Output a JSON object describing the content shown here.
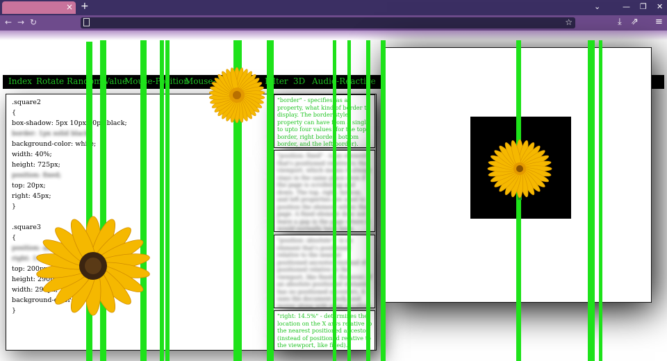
{
  "browser": {
    "tab_close": "×",
    "new_tab": "+",
    "dropdown": "⌄",
    "minimize": "—",
    "restore": "❐",
    "close": "✕",
    "back": "←",
    "forward": "→",
    "reload": "↻",
    "star": "☆",
    "download": "⤓",
    "extensions": "⇗",
    "menu": "≡"
  },
  "nav": [
    "Index",
    "Rotate",
    "Random-Value",
    "Mouse-Position",
    "Mouse-Scroll",
    "Filter",
    "3D",
    "Audio-Reactive"
  ],
  "code": [
    ".square2",
    "{",
    "box-shadow: 5px 10px 50px black;",
    "border: 1px solid black;",
    "background-color: white;",
    "width: 40%;",
    "height: 725px;",
    "position: fixed;",
    "top: 20px;",
    "right: 45px;",
    "}",
    "",
    ".square3",
    "{",
    "position: absolute;",
    "right: 14.5%;",
    "top: 200px;",
    "height: 290px;",
    "width: 290px;",
    "background-color: black;",
    "}"
  ],
  "info": [
    "\"border\" - specifies, as a property, what kind of border to display. The border-style property can have from a single to upto four values (for the top border, right border, bottom border, and the left border).",
    "\"position: fixed\" - is an element that's positioned relative to the viewport, which means it always stays in the same place even if the page is scrolled up and down. The top, right, bottom, and left properties are used to position the element within the page. A fixed element does not leave a gap in the page where it would normally have been located.",
    "\"position: absolute\" - is an element that's positioned relative to the nearest positioned ancestor (instead of positioned relative to the viewport, like fixed). However; if an absolute positioned element has no positioned ancestors, it uses the document body, and moves along with page scrolling.",
    "\"right: 14.5%\" - determines the location on the X axys relative to the nearest positioned ancestor (instead of positioned relative to the viewport, like fixed)."
  ],
  "colors": {
    "stripe": "#1ee21a",
    "nav_text": "#22c425",
    "petal": "#f5b800",
    "center": "#3b2410"
  }
}
